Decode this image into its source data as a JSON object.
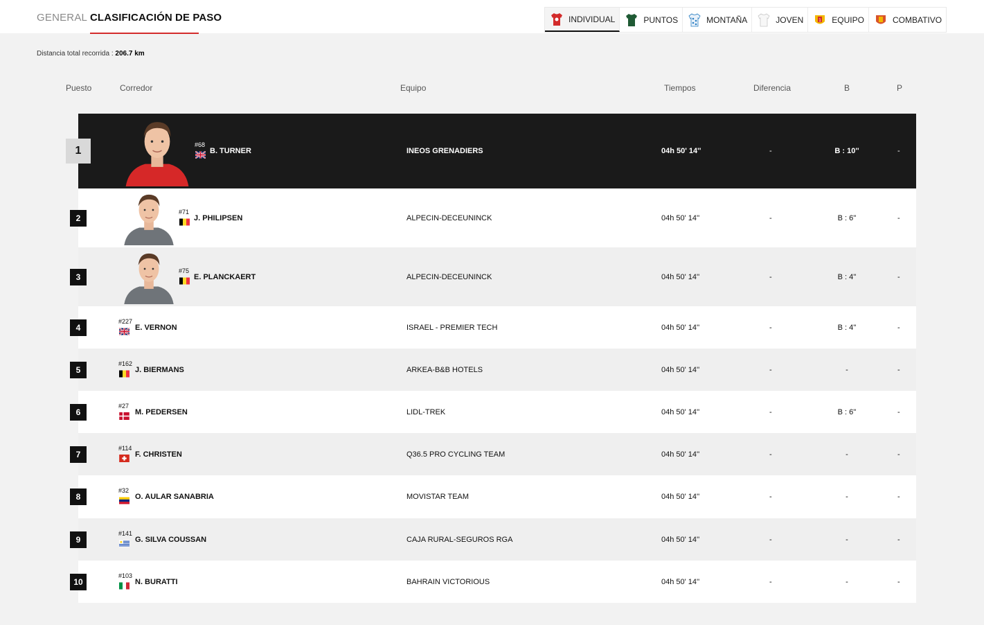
{
  "tabs": {
    "general": "GENERAL",
    "paso": "CLASIFICACIÓN DE PASO"
  },
  "jerseys": [
    {
      "label": "INDIVIDUAL",
      "icon": "red-jersey-icon",
      "color": "#d32b2b"
    },
    {
      "label": "PUNTOS",
      "icon": "green-jersey-icon",
      "color": "#1f6b3a"
    },
    {
      "label": "MONTAÑA",
      "icon": "polka-jersey-icon",
      "color": "#2a7fc2"
    },
    {
      "label": "JOVEN",
      "icon": "white-jersey-icon",
      "color": "#d9d9d9"
    },
    {
      "label": "EQUIPO",
      "icon": "team-icon",
      "color": "#e8a500"
    },
    {
      "label": "COMBATIVO",
      "icon": "combative-icon",
      "color": "#d9532b"
    }
  ],
  "distance": {
    "label": "Distancia total recorrida :",
    "value": "206.7 km"
  },
  "headers": {
    "pos": "Puesto",
    "rider": "Corredor",
    "team": "Equipo",
    "time": "Tiempos",
    "diff": "Diferencia",
    "b": "B",
    "p": "P"
  },
  "rows": [
    {
      "rank": "1",
      "num": "#68",
      "name": "B. TURNER",
      "flag": "GB",
      "team": "INEOS GRENADIERS",
      "time": "04h 50' 14''",
      "diff": "-",
      "b": "B : 10''",
      "p": "-"
    },
    {
      "rank": "2",
      "num": "#71",
      "name": "J. PHILIPSEN",
      "flag": "BE",
      "team": "ALPECIN-DECEUNINCK",
      "time": "04h 50' 14''",
      "diff": "-",
      "b": "B : 6''",
      "p": "-"
    },
    {
      "rank": "3",
      "num": "#75",
      "name": "E. PLANCKAERT",
      "flag": "BE",
      "team": "ALPECIN-DECEUNINCK",
      "time": "04h 50' 14''",
      "diff": "-",
      "b": "B : 4''",
      "p": "-"
    },
    {
      "rank": "4",
      "num": "#227",
      "name": "E. VERNON",
      "flag": "GB",
      "team": "ISRAEL - PREMIER TECH",
      "time": "04h 50' 14''",
      "diff": "-",
      "b": "B : 4''",
      "p": "-"
    },
    {
      "rank": "5",
      "num": "#162",
      "name": "J. BIERMANS",
      "flag": "BE",
      "team": "ARKEA-B&B HOTELS",
      "time": "04h 50' 14''",
      "diff": "-",
      "b": "-",
      "p": "-"
    },
    {
      "rank": "6",
      "num": "#27",
      "name": "M. PEDERSEN",
      "flag": "DK",
      "team": "LIDL-TREK",
      "time": "04h 50' 14''",
      "diff": "-",
      "b": "B : 6''",
      "p": "-"
    },
    {
      "rank": "7",
      "num": "#114",
      "name": "F. CHRISTEN",
      "flag": "CH",
      "team": "Q36.5 PRO CYCLING TEAM",
      "time": "04h 50' 14''",
      "diff": "-",
      "b": "-",
      "p": "-"
    },
    {
      "rank": "8",
      "num": "#32",
      "name": "O. AULAR SANABRIA",
      "flag": "VE",
      "team": "MOVISTAR TEAM",
      "time": "04h 50' 14''",
      "diff": "-",
      "b": "-",
      "p": "-"
    },
    {
      "rank": "9",
      "num": "#141",
      "name": "G. SILVA COUSSAN",
      "flag": "UY",
      "team": "CAJA RURAL-SEGUROS RGA",
      "time": "04h 50' 14''",
      "diff": "-",
      "b": "-",
      "p": "-"
    },
    {
      "rank": "10",
      "num": "#103",
      "name": "N. BURATTI",
      "flag": "IT",
      "team": "BAHRAIN VICTORIOUS",
      "time": "04h 50' 14''",
      "diff": "-",
      "b": "-",
      "p": "-"
    }
  ]
}
